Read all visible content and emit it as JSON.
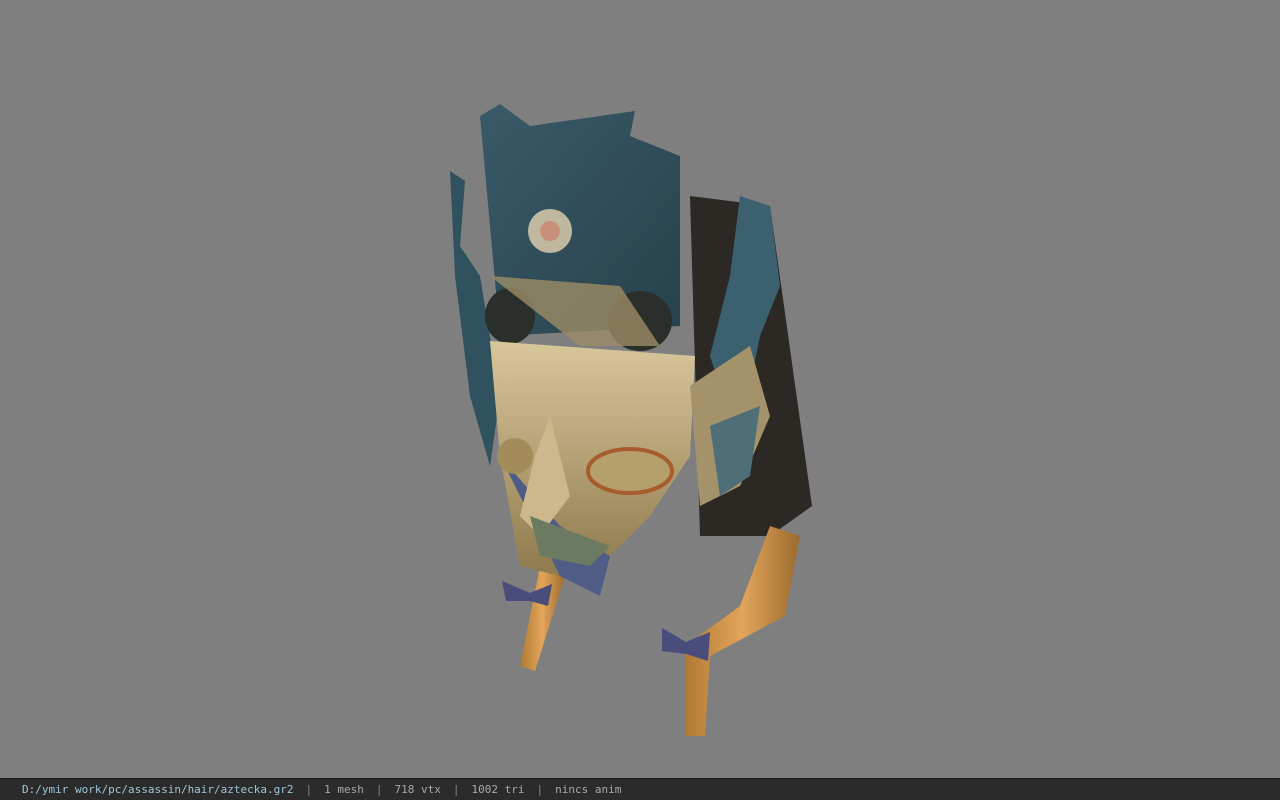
{
  "viewport": {
    "background_color": "#7f7f7f",
    "model_icon": "3d-mask-model"
  },
  "status": {
    "file_path": "D:/ymir work/pc/assassin/hair/aztecka.gr2",
    "separator": "|",
    "mesh_count": "1 mesh",
    "vertex_count": "718 vtx",
    "triangle_count": "1002 tri",
    "anim": "nincs anim"
  }
}
